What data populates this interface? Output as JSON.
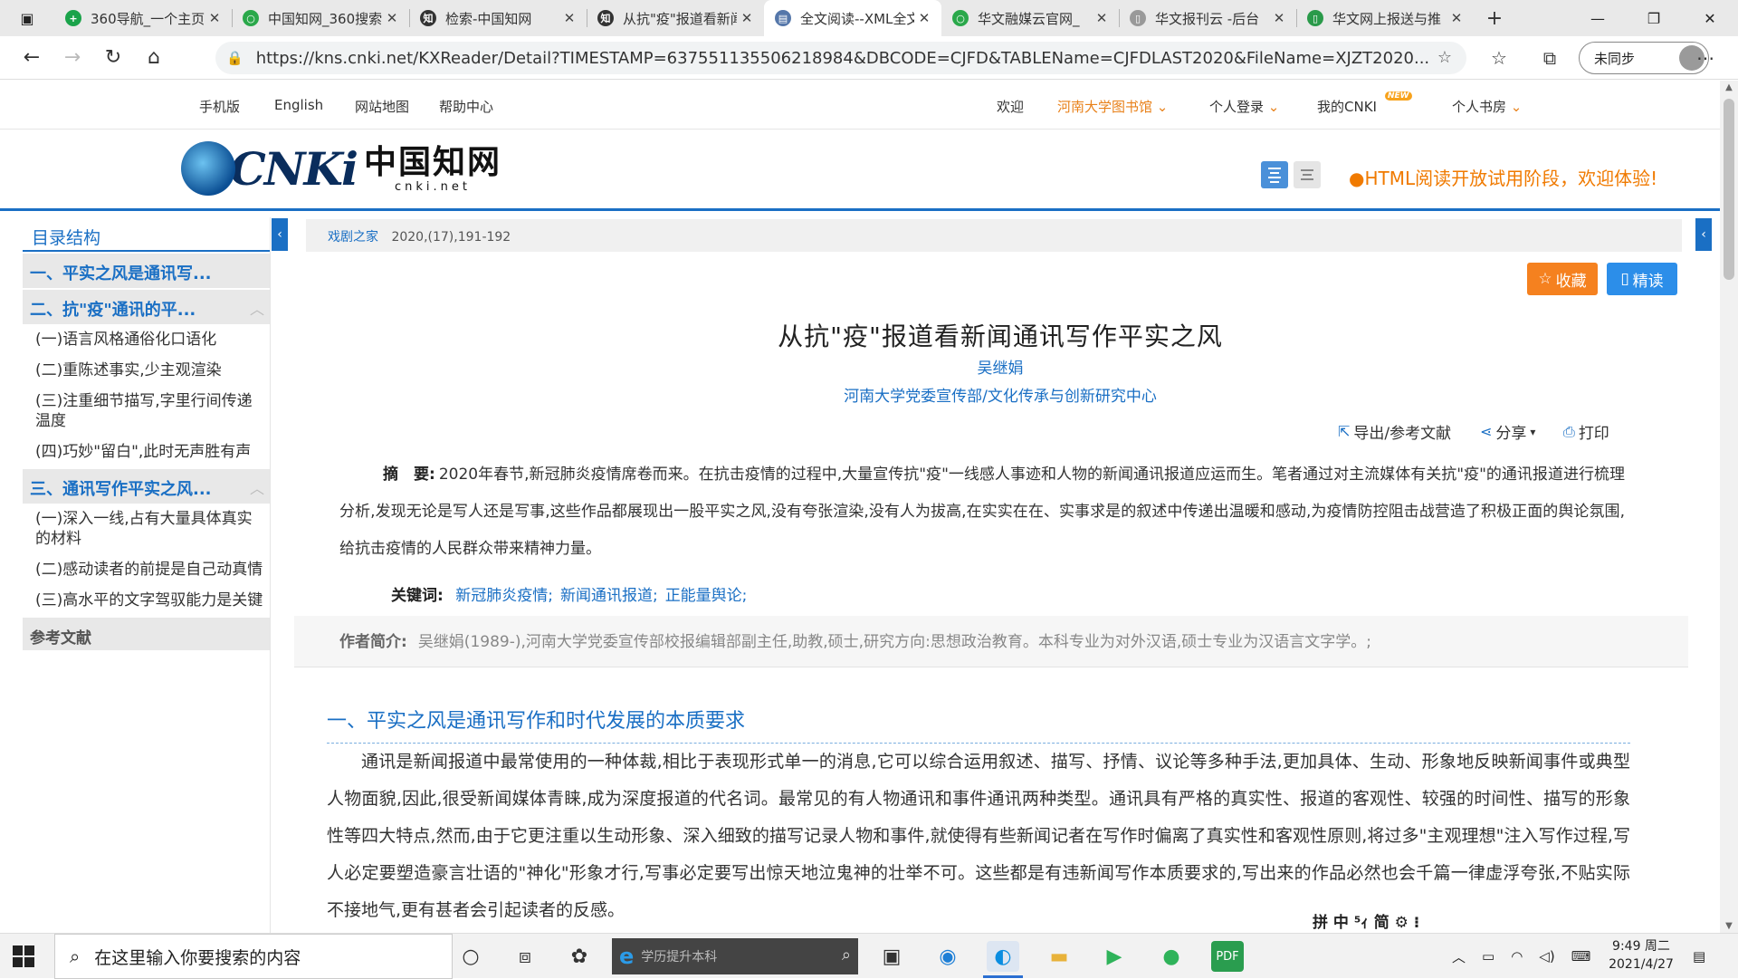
{
  "browser": {
    "tabs": [
      {
        "title": "360导航_一个主页",
        "fav_color": "#1aa34a",
        "fav_glyph": "+"
      },
      {
        "title": "中国知网_360搜索",
        "fav_color": "#2aa84a",
        "fav_glyph": "○"
      },
      {
        "title": "检索-中国知网",
        "fav_color": "#333333",
        "fav_glyph": "知"
      },
      {
        "title": "从抗\"疫\"报道看新闻",
        "fav_color": "#333333",
        "fav_glyph": "知"
      },
      {
        "title": "全文阅读--XML全文",
        "fav_color": "#5577aa",
        "fav_glyph": "▤",
        "active": true
      },
      {
        "title": "华文融媒云官网_",
        "fav_color": "#2aa84a",
        "fav_glyph": "○"
      },
      {
        "title": "华文报刊云 -后台",
        "fav_color": "#999999",
        "fav_glyph": "▯"
      },
      {
        "title": "华文网上报送与推",
        "fav_color": "#2a9a4a",
        "fav_glyph": "▯"
      }
    ],
    "url": "https://kns.cnki.net/KXReader/Detail?TIMESTAMP=637551135506218984&DBCODE=CJFD&TABLEName=CJFDLAST2020&FileName=XJZT2020...",
    "profile_label": "未同步"
  },
  "topnav": {
    "mobile": "手机版",
    "english": "English",
    "sitemap": "网站地图",
    "help": "帮助中心",
    "welcome": "欢迎",
    "library": "河南大学图书馆",
    "login": "个人登录",
    "my_cnki": "我的CNKI",
    "new_badge": "NEW",
    "bookroom": "个人书房"
  },
  "header": {
    "logo_main": "CNKi",
    "logo_zh": "中国知网",
    "logo_sub": "cnki.net",
    "tip": "HTML阅读开放试用阶段，欢迎体验!"
  },
  "sidebar": {
    "title": "目录结构",
    "sec1": "一、平实之风是通讯写...",
    "sec2": "二、抗\"疫\"通讯的平...",
    "sec2_items": [
      "(一)语言风格通俗化口语化",
      "(二)重陈述事实,少主观渲染",
      "(三)注重细节描写,字里行间传递温度",
      "(四)巧妙\"留白\",此时无声胜有声"
    ],
    "sec3": "三、通讯写作平实之风...",
    "sec3_items": [
      "(一)深入一线,占有大量具体真实的材料",
      "(二)感动读者的前提是自己动真情",
      "(三)高水平的文字驾驭能力是关键"
    ],
    "refs": "参考文献"
  },
  "article": {
    "source": "戏剧之家",
    "volume": "2020,(17),191-192",
    "fav_label": "收藏",
    "read_label": "精读",
    "title": "从抗\"疫\"报道看新闻通讯写作平实之风",
    "author": "吴继娟",
    "affiliation": "河南大学党委宣传部/文化传承与创新研究中心",
    "export_label": "导出/参考文献",
    "share_label": "分享",
    "print_label": "打印",
    "abstract_label": "摘　要:",
    "abstract": "2020年春节,新冠肺炎疫情席卷而来。在抗击疫情的过程中,大量宣传抗\"疫\"一线感人事迹和人物的新闻通讯报道应运而生。笔者通过对主流媒体有关抗\"疫\"的通讯报道进行梳理分析,发现无论是写人还是写事,这些作品都展现出一股平实之风,没有夸张渲染,没有人为拔高,在实实在在、实事求是的叙述中传递出温暖和感动,为疫情防控阻击战营造了积极正面的舆论氛围,给抗击疫情的人民群众带来精神力量。",
    "keywords_label": "关键词:",
    "keywords": [
      "新冠肺炎疫情;",
      "新闻通讯报道;",
      "正能量舆论;"
    ],
    "bio_label": "作者简介:",
    "bio": "吴继娟(1989-),河南大学党委宣传部校报编辑部副主任,助教,硕士,研究方向:思想政治教育。本科专业为对外汉语,硕士专业为汉语言文字学。;",
    "section1_title": "一、平实之风是通讯写作和时代发展的本质要求",
    "section1_text": "通讯是新闻报道中最常使用的一种体裁,相比于表现形式单一的消息,它可以综合运用叙述、描写、抒情、议论等多种手法,更加具体、生动、形象地反映新闻事件或典型人物面貌,因此,很受新闻媒体青睐,成为深度报道的代名词。最常见的有人物通讯和事件通讯两种类型。通讯具有严格的真实性、报道的客观性、较强的时间性、描写的形象性等四大特点,然而,由于它更注重以生动形象、深入细致的描写记录人物和事件,就使得有些新闻记者在写作时偏离了真实性和客观性原则,将过多\"主观理想\"注入写作过程,写人必定要塑造豪言壮语的\"神化\"形象才行,写事必定要写出惊天地泣鬼神的壮举不可。这些都是有违新闻写作本质要求的,写出来的作品必然也会千篇一律虚浮夸张,不贴实际不接地气,更有甚者会引起读者的反感。"
  },
  "ime": {
    "text": "拼 中 ⁵ｨ 简 ⚙ ⁝"
  },
  "taskbar": {
    "search_placeholder": "在这里输入你要搜索的内容",
    "edge_search_placeholder": "学历提升本科",
    "time": "9:49 周二",
    "date": "2021/4/27"
  }
}
